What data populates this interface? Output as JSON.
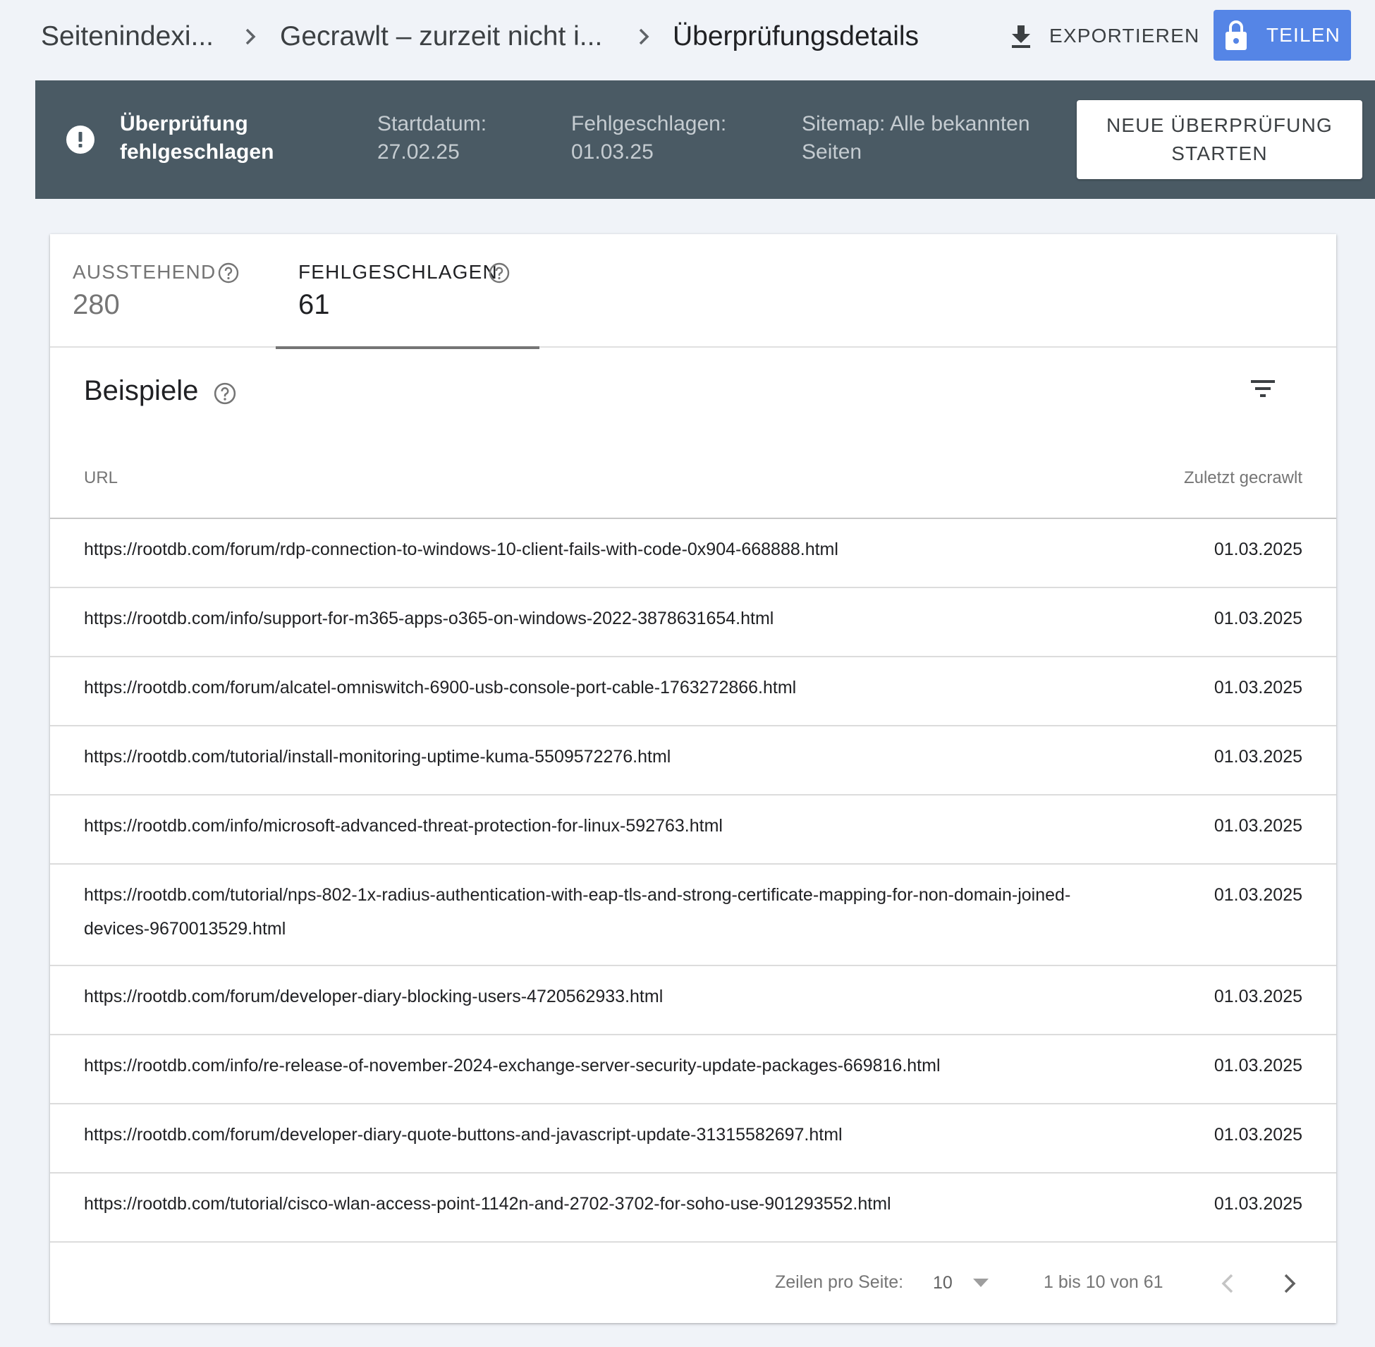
{
  "breadcrumb": {
    "items": [
      "Seitenindexi...",
      "Gecrawlt – zurzeit nicht i...",
      "Überprüfungsdetails"
    ]
  },
  "toolbar": {
    "export_label": "EXPORTIEREN",
    "share_label": "TEILEN"
  },
  "banner": {
    "status": "Überprüfung fehlgeschlagen",
    "start_label": "Startdatum:",
    "start_value": "27.02.25",
    "failed_label": "Fehlgeschlagen:",
    "failed_value": "01.03.25",
    "sitemap": "Sitemap: Alle bekannten Seiten",
    "restart_label": "NEUE ÜBERPRÜFUNG STARTEN"
  },
  "tabs": [
    {
      "label": "AUSSTEHEND",
      "count": "280",
      "active": false
    },
    {
      "label": "FEHLGESCHLAGEN",
      "count": "61",
      "active": true
    }
  ],
  "examples": {
    "title": "Beispiele",
    "columns": {
      "url": "URL",
      "date": "Zuletzt gecrawlt"
    },
    "rows": [
      {
        "url": "https://rootdb.com/forum/rdp-connection-to-windows-10-client-fails-with-code-0x904-668888.html",
        "date": "01.03.2025"
      },
      {
        "url": "https://rootdb.com/info/support-for-m365-apps-o365-on-windows-2022-3878631654.html",
        "date": "01.03.2025"
      },
      {
        "url": "https://rootdb.com/forum/alcatel-omniswitch-6900-usb-console-port-cable-1763272866.html",
        "date": "01.03.2025"
      },
      {
        "url": "https://rootdb.com/tutorial/install-monitoring-uptime-kuma-5509572276.html",
        "date": "01.03.2025"
      },
      {
        "url": "https://rootdb.com/info/microsoft-advanced-threat-protection-for-linux-592763.html",
        "date": "01.03.2025"
      },
      {
        "url": "https://rootdb.com/tutorial/nps-802-1x-radius-authentication-with-eap-tls-and-strong-certificate-mapping-for-non-domain-joined-devices-9670013529.html",
        "date": "01.03.2025"
      },
      {
        "url": "https://rootdb.com/forum/developer-diary-blocking-users-4720562933.html",
        "date": "01.03.2025"
      },
      {
        "url": "https://rootdb.com/info/re-release-of-november-2024-exchange-server-security-update-packages-669816.html",
        "date": "01.03.2025"
      },
      {
        "url": "https://rootdb.com/forum/developer-diary-quote-buttons-and-javascript-update-31315582697.html",
        "date": "01.03.2025"
      },
      {
        "url": "https://rootdb.com/tutorial/cisco-wlan-access-point-1142n-and-2702-3702-for-soho-use-901293552.html",
        "date": "01.03.2025"
      }
    ]
  },
  "pagination": {
    "rows_per_page_label": "Zeilen pro Seite:",
    "rows_per_page_value": "10",
    "range": "1 bis 10 von 61"
  },
  "colors": {
    "banner_bg": "#4a5a64",
    "share_button": "#5585e6",
    "page_bg": "#f0f3f8"
  }
}
